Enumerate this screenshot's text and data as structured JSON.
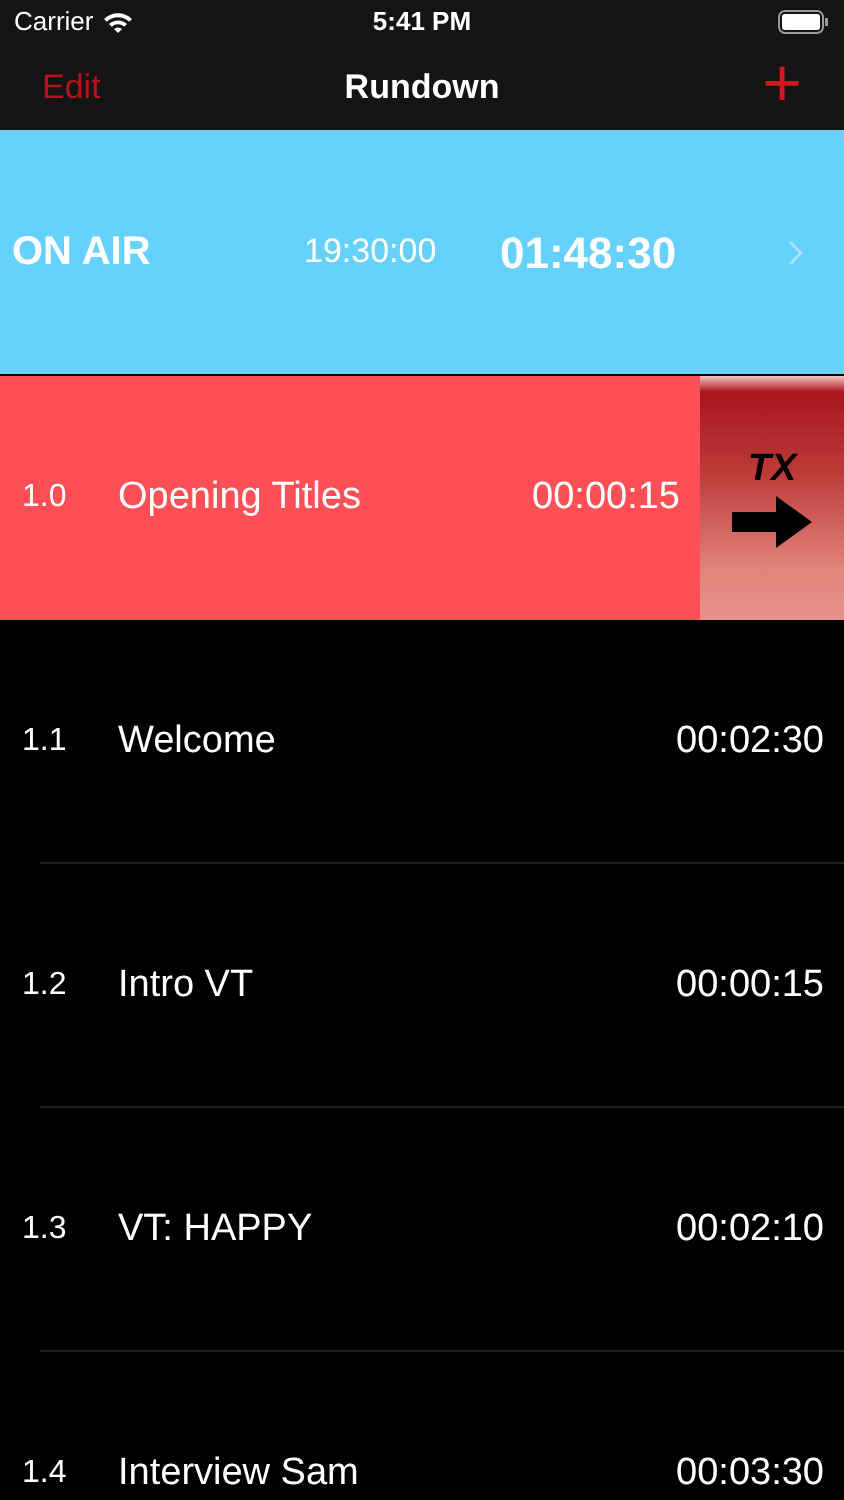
{
  "status_bar": {
    "carrier": "Carrier",
    "time": "5:41 PM"
  },
  "nav": {
    "left": "Edit",
    "title": "Rundown",
    "right": "+"
  },
  "on_air": {
    "label": "ON AIR",
    "start_time": "19:30:00",
    "elapsed": "01:48:30"
  },
  "rows": [
    {
      "kind": "cued",
      "number": "1.0",
      "title": "Opening Titles",
      "duration": "00:00:15",
      "action": "TX"
    },
    {
      "kind": "item",
      "number": "1.1",
      "title": "Welcome",
      "duration": "00:02:30"
    },
    {
      "kind": "item",
      "number": "1.2",
      "title": "Intro VT",
      "duration": "00:00:15"
    },
    {
      "kind": "item",
      "number": "1.3",
      "title": "VT: HAPPY",
      "duration": "00:02:10"
    },
    {
      "kind": "item",
      "number": "1.4",
      "title": "Interview Sam",
      "duration": "00:03:30"
    }
  ]
}
